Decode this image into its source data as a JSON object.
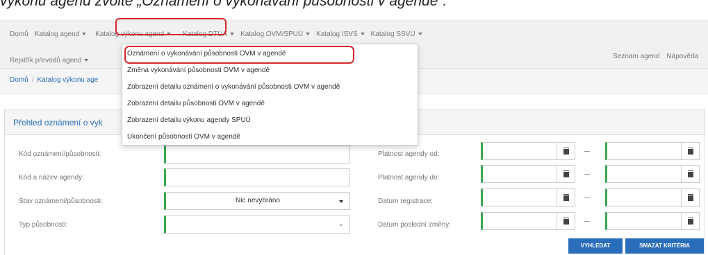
{
  "caption": "výkonu agend zvolte „Oznámení o vykonávání působnosti v agendě“.",
  "nav": {
    "row1": [
      "Domů",
      "Katalog agend",
      "Katalog výkonu agend",
      "Katalog DTÚA",
      "Katalog OVM/SPUÚ",
      "Katalog ISVS",
      "Katalog SSVÚ"
    ],
    "row2": [
      "Rejstřík převodů agend"
    ],
    "right": [
      "Seznam agend",
      "Nápověda"
    ]
  },
  "breadcrumb": [
    "Domů",
    "Katalog výkonu age"
  ],
  "dropdown": {
    "items": [
      "Oznámení o vykonávání působnosti OVM v agendě",
      "Změna vykonávání působnosti OVM v agendě",
      "Zobrazení detailu oznámení o vykonávání působnosti OVM v agendě",
      "Zobrazení detailu působnosti OVM v agendě",
      "Zobrazení detailu výkonu agendy SPUÚ",
      "Ukončení působnosti OVM v agendě"
    ]
  },
  "panel": {
    "title": "Přehled oznámení o vyk",
    "left_labels": [
      "Kód oznámení/působnosti:",
      "Kód a název agendy:",
      "Stav oznámení/působnosti:",
      "Typ působnosti:"
    ],
    "status_value": "Nic nevybráno",
    "right_labels": [
      "Platnost agendy od:",
      "Platnost agendy do:",
      "Datum registrace:",
      "Datum poslední změny:"
    ]
  },
  "buttons": {
    "search": "VYHLEDAT",
    "clear": "SMAZAT KRITÉRIA"
  },
  "colors": {
    "accent": "#2a6ebb",
    "highlight": "#d9262c",
    "required": "#3aa74f"
  }
}
